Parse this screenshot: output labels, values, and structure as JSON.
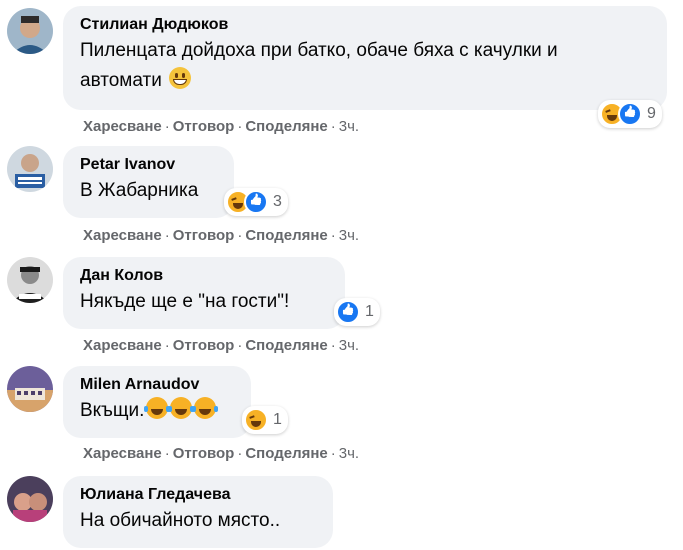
{
  "actions": {
    "like": "Харесване",
    "reply": "Отговор",
    "share": "Споделяне",
    "sep": "·"
  },
  "comments": [
    {
      "author": "Стилиан Дюдюков",
      "text_line1": "Пиленцата дойдоха при батко, обаче бяха с качулки и",
      "text_line2": "автомати",
      "reactions": [
        "haha",
        "like"
      ],
      "reaction_count": "9",
      "time": "3ч.",
      "avatar_color": "#7a9fbf"
    },
    {
      "author": "Petar Ivanov",
      "text": "В Жабарника",
      "reactions": [
        "haha",
        "like"
      ],
      "reaction_count": "3",
      "time": "3ч.",
      "avatar_color": "#3b6ea8"
    },
    {
      "author": "Дан Колов",
      "text": "Някъде ще е \"на гости\"!",
      "reactions": [
        "like"
      ],
      "reaction_count": "1",
      "time": "3ч.",
      "avatar_color": "#555555"
    },
    {
      "author": "Milen Arnaudov",
      "text": "Вкъщи.",
      "reactions": [
        "haha"
      ],
      "reaction_count": "1",
      "time": "3ч.",
      "avatar_color": "#6a5a8e"
    },
    {
      "author": "Юлиана Гледачева",
      "text": "На обичайното място..",
      "avatar_color": "#b05a7a"
    }
  ]
}
